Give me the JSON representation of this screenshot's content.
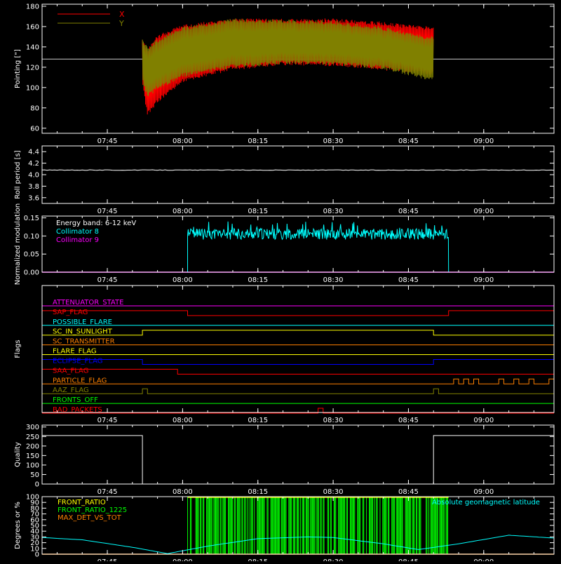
{
  "x_ticks": [
    "07:45",
    "08:00",
    "08:15",
    "08:30",
    "08:45",
    "09:00"
  ],
  "colors": {
    "background": "#000000",
    "axis": "#ffffff",
    "x_series": "#ff0000",
    "y_series": "#808000",
    "roll": "#ffffff",
    "collimator8": "#00ffff",
    "collimator9": "#ff00ff",
    "quality": "#ffffff",
    "front_ratio": "#ffff00",
    "front_ratio_1225": "#00ff00",
    "max_det": "#ff8000",
    "geomag": "#00ffff"
  },
  "chart_data": [
    {
      "type": "line",
      "name": "pointing",
      "ylabel": "Pointing [\"]",
      "ylim": [
        55,
        182
      ],
      "yticks": [
        60,
        80,
        100,
        120,
        140,
        160,
        180
      ],
      "x_range": [
        "07:32",
        "09:14"
      ],
      "reference_line": 128,
      "legend": [
        "X",
        "Y"
      ],
      "legend_placement": "top-left",
      "series": [
        {
          "name": "X",
          "x": [
            "07:52",
            "07:53",
            "07:55",
            "08:00",
            "08:10",
            "08:20",
            "08:30",
            "08:40",
            "08:45",
            "08:50"
          ],
          "min": [
            102,
            72,
            85,
            105,
            117,
            122,
            121,
            117,
            114,
            112
          ],
          "max": [
            150,
            138,
            152,
            162,
            168,
            168,
            168,
            165,
            162,
            160
          ]
        },
        {
          "name": "Y",
          "x": [
            "07:52",
            "07:53",
            "07:55",
            "08:00",
            "08:10",
            "08:20",
            "08:30",
            "08:40",
            "08:45",
            "08:50"
          ],
          "min": [
            105,
            90,
            98,
            110,
            119,
            123,
            122,
            118,
            112,
            106
          ],
          "max": [
            148,
            140,
            148,
            160,
            168,
            167,
            166,
            160,
            155,
            150
          ]
        }
      ]
    },
    {
      "type": "line",
      "name": "roll-period",
      "ylabel": "Roll period [s]",
      "ylim": [
        3.5,
        4.5
      ],
      "yticks": [
        "3.6",
        "3.8",
        "4.0",
        "4.2",
        "4.4"
      ],
      "series": [
        {
          "name": "roll",
          "x": [
            "07:32",
            "09:14"
          ],
          "y": [
            4.08,
            4.08
          ]
        }
      ]
    },
    {
      "type": "line",
      "name": "modulation",
      "ylabel": "Normalized modulation",
      "ylim": [
        0,
        0.155
      ],
      "yticks": [
        "0.00",
        "0.05",
        "0.10",
        "0.15"
      ],
      "annotation": "Energy band: 6-12 keV",
      "legend": [
        "Collimator 8",
        "Collimator 9"
      ],
      "series": [
        {
          "name": "Collimator 8",
          "start": "08:01",
          "end": "08:53",
          "low": 0.09,
          "high": 0.14
        },
        {
          "name": "Collimator 9",
          "x": [
            "07:32",
            "09:14"
          ],
          "y": [
            0,
            0
          ]
        }
      ]
    },
    {
      "type": "line",
      "name": "flags",
      "ylabel": "Flags",
      "flags": [
        {
          "label": "ATTENUATOR_STATE",
          "color": "#ff00ff",
          "on": []
        },
        {
          "label": "SAP_FLAG",
          "color": "#ff0000",
          "on": [
            [
              "07:32",
              "08:01"
            ],
            [
              "08:53",
              "09:14"
            ]
          ]
        },
        {
          "label": "POSSIBLE_FLARE",
          "color": "#00ffff",
          "on": []
        },
        {
          "label": "SC_IN_SUNLIGHT",
          "color": "#ffff00",
          "on": [
            [
              "07:52",
              "08:50"
            ]
          ]
        },
        {
          "label": "SC_TRANSMITTER",
          "color": "#ff8000",
          "on": []
        },
        {
          "label": "FLARE_FLAG",
          "color": "#ffff00",
          "on": []
        },
        {
          "label": "ECLIPSE_FLAG",
          "color": "#0000ff",
          "on": [
            [
              "07:32",
              "07:52"
            ],
            [
              "08:50",
              "09:14"
            ]
          ]
        },
        {
          "label": "SAA_FLAG",
          "color": "#ff0000",
          "on": [
            [
              "07:32",
              "07:59"
            ]
          ]
        },
        {
          "label": "PARTICLE_FLAG",
          "color": "#ff8000",
          "on": [
            [
              "08:54",
              "08:55"
            ],
            [
              "08:56",
              "08:57"
            ],
            [
              "08:58",
              "08:59"
            ],
            [
              "09:03",
              "09:04"
            ],
            [
              "09:06",
              "09:07"
            ],
            [
              "09:09",
              "09:10"
            ],
            [
              "09:13",
              "09:14"
            ]
          ]
        },
        {
          "label": "AAZ_FLAG",
          "color": "#808000",
          "on": [
            [
              "07:52",
              "07:53"
            ],
            [
              "08:50",
              "08:51"
            ]
          ]
        },
        {
          "label": "FRONTS_OFF",
          "color": "#00ff00",
          "on": []
        },
        {
          "label": "BAD_PACKETS",
          "color": "#ff0000",
          "on": [
            [
              "08:27",
              "08:28"
            ]
          ]
        }
      ]
    },
    {
      "type": "line",
      "name": "quality",
      "ylabel": "Quality",
      "ylim": [
        0,
        310
      ],
      "yticks": [
        0,
        50,
        100,
        150,
        200,
        250,
        300
      ],
      "series": [
        {
          "name": "quality",
          "x": [
            "07:32",
            "07:52",
            "07:52",
            "08:50",
            "08:50",
            "09:14"
          ],
          "y": [
            255,
            255,
            0,
            0,
            255,
            255
          ]
        }
      ]
    },
    {
      "type": "line",
      "name": "ratios",
      "ylabel": "Degrees or %",
      "ylim": [
        0,
        100
      ],
      "yticks": [
        0,
        10,
        20,
        30,
        40,
        50,
        60,
        70,
        80,
        90,
        100
      ],
      "legend": [
        "FRONT_RATIO",
        "FRONT_RATIO_1225",
        "MAX_DET_VS_TOT"
      ],
      "annotation": "Absolute geomagnetic latitude",
      "series": [
        {
          "name": "FRONT_RATIO",
          "start": "08:01",
          "end": "08:53",
          "value": 100
        },
        {
          "name": "FRONT_RATIO_1225",
          "start": "08:01",
          "end": "08:53",
          "value": 100
        },
        {
          "name": "MAX_DET_VS_TOT",
          "x": [
            "07:32",
            "09:14"
          ],
          "y": [
            0,
            0
          ]
        },
        {
          "name": "Absolute geomagnetic latitude",
          "x": [
            "07:32",
            "07:40",
            "07:50",
            "07:57",
            "08:05",
            "08:15",
            "08:25",
            "08:30",
            "08:40",
            "08:47",
            "08:55",
            "09:05",
            "09:14"
          ],
          "y": [
            29,
            25,
            12,
            1,
            14,
            27,
            30,
            29,
            18,
            8,
            18,
            33,
            28
          ]
        }
      ]
    }
  ]
}
